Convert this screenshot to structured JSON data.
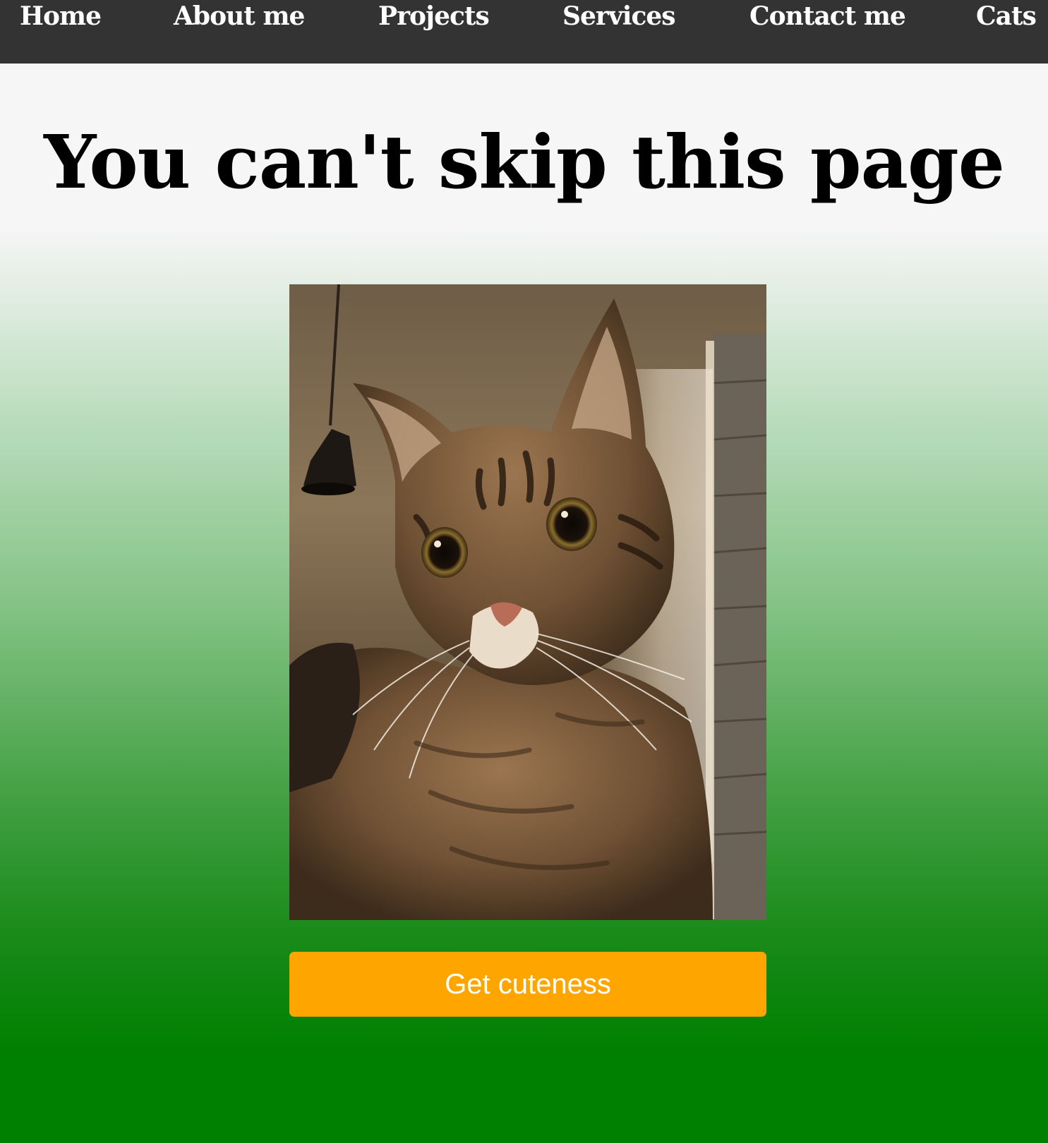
{
  "nav": {
    "items": [
      {
        "label": "Home"
      },
      {
        "label": "About me"
      },
      {
        "label": "Projects"
      },
      {
        "label": "Services"
      },
      {
        "label": "Contact me"
      },
      {
        "label": "Cats"
      }
    ],
    "background": "#333333",
    "text_color": "#ffffff"
  },
  "hero": {
    "title": "You can't skip this page"
  },
  "photo": {
    "subject": "tabby-cat-photo"
  },
  "cta": {
    "label": "Get cuteness",
    "color": "#ffa500"
  },
  "background": {
    "gradient_from": "#f6f6f6",
    "gradient_to": "#008000"
  }
}
